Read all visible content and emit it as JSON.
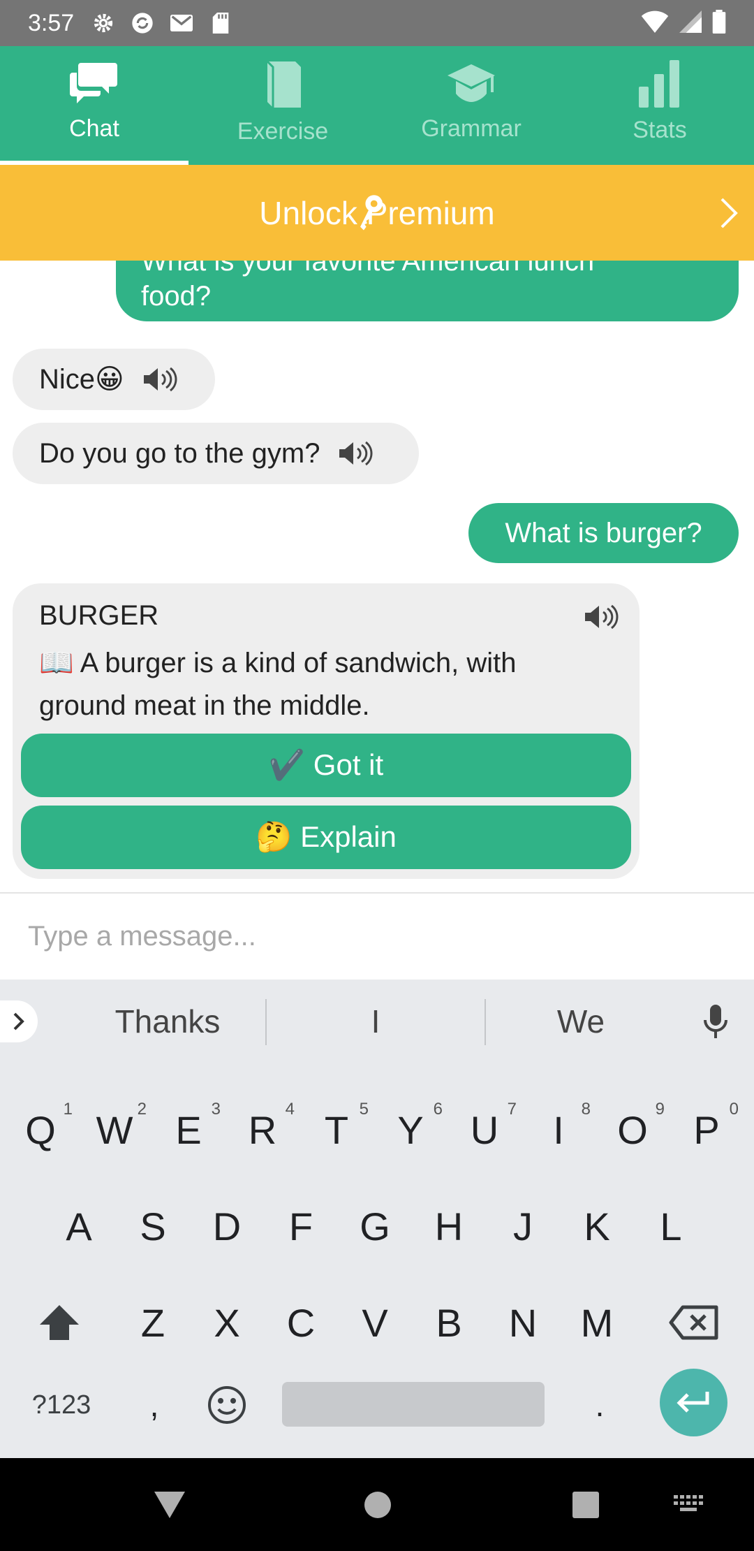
{
  "status_bar": {
    "time": "3:57"
  },
  "tabs": [
    {
      "label": "Chat",
      "icon": "chat-icon",
      "active": true
    },
    {
      "label": "Exercise",
      "icon": "book-icon",
      "active": false
    },
    {
      "label": "Grammar",
      "icon": "graduation-cap-icon",
      "active": false
    },
    {
      "label": "Stats",
      "icon": "bar-chart-icon",
      "active": false
    }
  ],
  "premium_banner": {
    "label": "Unlock Premium"
  },
  "chat": {
    "messages": [
      {
        "from": "user",
        "text_line1": "What is your favorite American lunch",
        "text_line2": "food?"
      },
      {
        "from": "bot",
        "text": "Nice😀"
      },
      {
        "from": "bot",
        "text": "Do you go to the gym?"
      },
      {
        "from": "user",
        "text": "What is burger?"
      }
    ],
    "definition_card": {
      "word": "BURGER",
      "definition": "📖 A burger is a kind of sandwich, with ground meat in the middle.",
      "got_it_label": "✔️ Got it",
      "explain_label": "🤔 Explain"
    }
  },
  "input": {
    "placeholder": "Type a message...",
    "value": ""
  },
  "keyboard": {
    "suggestions": [
      "Thanks",
      "I",
      "We"
    ],
    "row1": [
      "Q",
      "W",
      "E",
      "R",
      "T",
      "Y",
      "U",
      "I",
      "O",
      "P"
    ],
    "row1_hints": [
      "1",
      "2",
      "3",
      "4",
      "5",
      "6",
      "7",
      "8",
      "9",
      "0"
    ],
    "row2": [
      "A",
      "S",
      "D",
      "F",
      "G",
      "H",
      "J",
      "K",
      "L"
    ],
    "row3": [
      "Z",
      "X",
      "C",
      "V",
      "B",
      "N",
      "M"
    ],
    "symbols_label": "?123",
    "comma_label": ",",
    "period_label": "."
  },
  "colors": {
    "primary": "#30b387",
    "premium": "#f9be38",
    "bubble_in": "#eeeeee"
  }
}
